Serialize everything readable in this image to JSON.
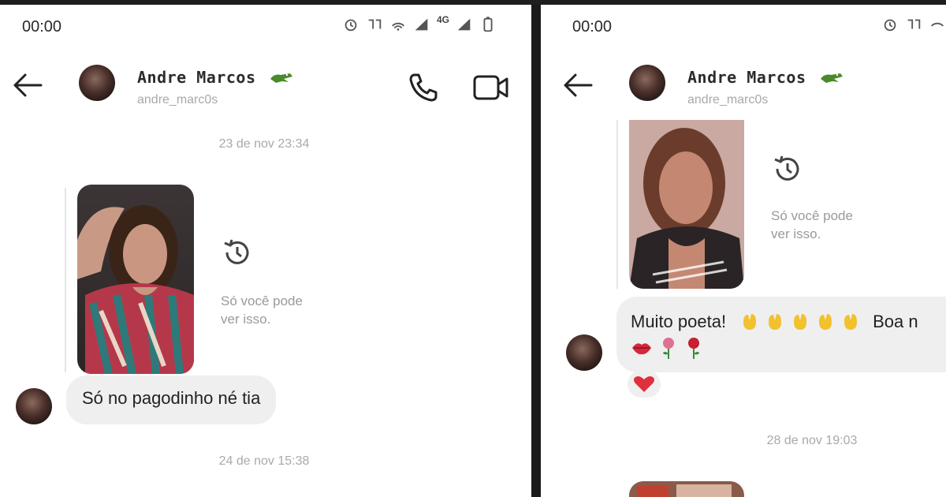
{
  "left": {
    "status": {
      "time": "00:00",
      "network": "4G"
    },
    "header": {
      "name": "Andre Marcos",
      "username": "andre_marc0s"
    },
    "timestamps": [
      "23 de nov 23:34",
      "24 de nov 15:38"
    ],
    "story_caption": [
      "Só você pode",
      "ver isso."
    ],
    "messages": [
      {
        "text": "Só no pagodinho né tia"
      }
    ]
  },
  "right": {
    "status": {
      "time": "00:00"
    },
    "header": {
      "name": "Andre Marcos",
      "username": "andre_marc0s"
    },
    "timestamps": [
      "28 de nov 19:03"
    ],
    "story_caption": [
      "Só você pode",
      "ver isso."
    ],
    "messages": [
      {
        "text": "Muito poeta!",
        "trailing_text": "Boa n",
        "emojis": [
          "clapping-hands-icon",
          "clapping-hands-icon",
          "clapping-hands-icon",
          "clapping-hands-icon",
          "clapping-hands-icon",
          "lips-icon",
          "rose-icon",
          "rose-icon"
        ],
        "reaction": "heart-icon"
      }
    ]
  },
  "colors": {
    "bubble": "#efefef",
    "timestamp": "#a9a9a9",
    "caption": "#9a9a9a",
    "clap": "#f2c12e",
    "heart": "#e03040"
  }
}
